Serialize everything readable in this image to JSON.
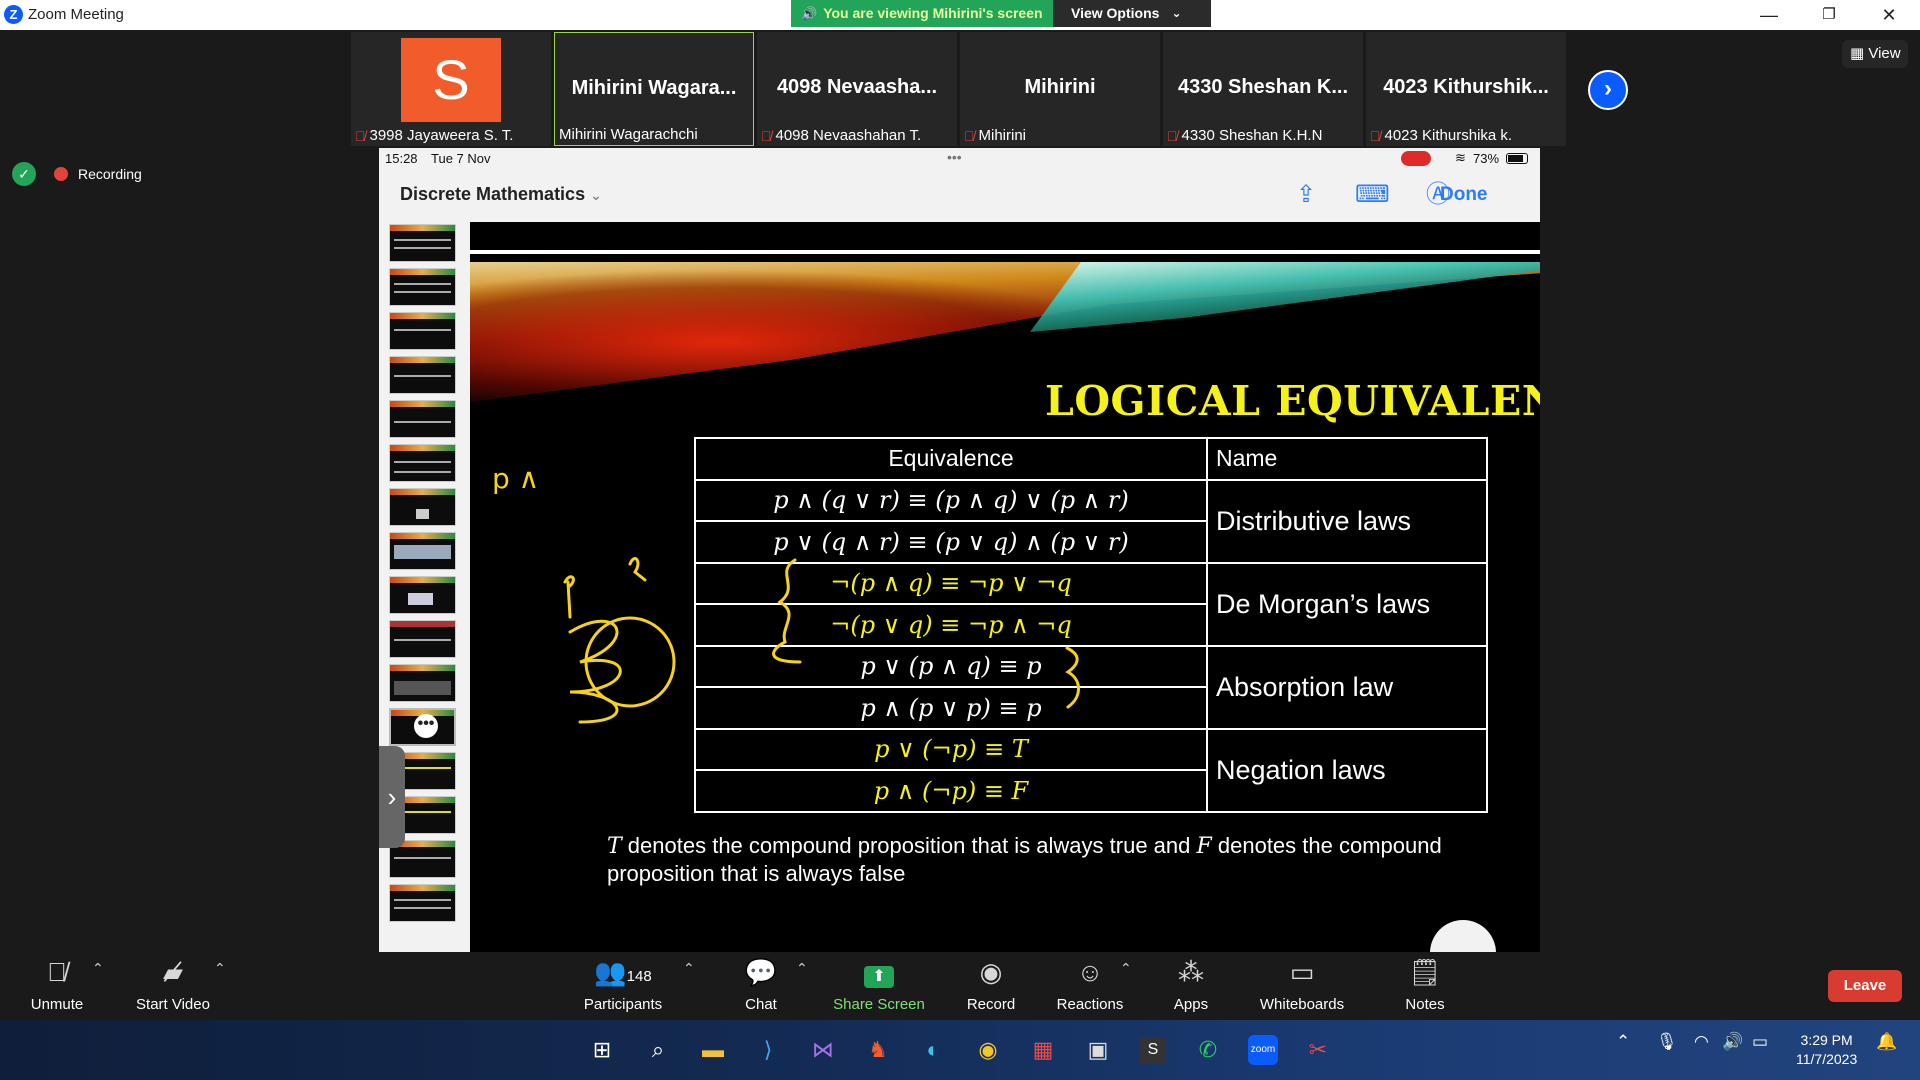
{
  "window": {
    "title": "Zoom Meeting",
    "minimize": "—",
    "restore": "❐",
    "close": "✕"
  },
  "share_banner": {
    "viewing_text": "You are viewing Mihirini's screen",
    "view_options": "View Options"
  },
  "participants": [
    {
      "name": "",
      "label": "3998 Jayaweera S. T.",
      "avatar_letter": "S",
      "muted": true
    },
    {
      "name": "Mihirini  Wagara...",
      "label": "Mihirini Wagarachchi",
      "muted": false,
      "active": true
    },
    {
      "name": "4098  Nevaasha...",
      "label": "4098 Nevaashahan T.",
      "muted": true
    },
    {
      "name": "Mihirini",
      "label": "Mihirini",
      "muted": true
    },
    {
      "name": "4330  Sheshan  K...",
      "label": "4330 Sheshan K.H.N",
      "muted": true
    },
    {
      "name": "4023  Kithurshik...",
      "label": "4023 Kithurshika k.",
      "muted": true
    }
  ],
  "view_button": "View",
  "recording": {
    "label": "Recording"
  },
  "ipad": {
    "time": "15:28",
    "date": "Tue 7 Nov",
    "dots": "•••",
    "battery": "73%",
    "doc_title": "Discrete Mathematics",
    "done": "Done"
  },
  "slide": {
    "title": "LOGICAL EQUIVALENC",
    "col_equivalence": "Equivalence",
    "col_name": "Name",
    "rows": [
      {
        "formula": "p ∧ (q ∨ r) ≡ (p ∧ q) ∨ (p ∧ r)",
        "yellow": false
      },
      {
        "formula": "p ∨ (q ∧ r) ≡ (p ∨ q) ∧ (p ∨ r)",
        "yellow": false
      },
      {
        "formula": "¬(p ∧ q) ≡ ¬p ∨ ¬q",
        "yellow": true
      },
      {
        "formula": "¬(p ∨ q) ≡ ¬p ∧ ¬q",
        "yellow": true
      },
      {
        "formula": "p ∨ (p ∧ q) ≡ p",
        "yellow": false
      },
      {
        "formula": "p ∧ (p ∨ p) ≡ p",
        "yellow": false
      },
      {
        "formula": "p ∨ (¬p) ≡ T",
        "yellow": true
      },
      {
        "formula": "p ∧ (¬p) ≡ F",
        "yellow": true
      }
    ],
    "laws": [
      "Distributive laws",
      "De Morgan’s laws",
      "Absorption law",
      "Negation laws"
    ],
    "caption_t": "T",
    "caption_1": " denotes the compound proposition that is always true and ",
    "caption_f": "F",
    "caption_2": " denotes the compound proposition that is always false",
    "annotation_text": "p ∧"
  },
  "toolbar": {
    "unmute": "Unmute",
    "start_video": "Start Video",
    "participants_count": "148",
    "participants": "Participants",
    "chat": "Chat",
    "share_screen": "Share Screen",
    "record": "Record",
    "reactions": "Reactions",
    "apps": "Apps",
    "whiteboards": "Whiteboards",
    "notes": "Notes",
    "leave": "Leave"
  },
  "taskbar": {
    "time": "3:29 PM",
    "date": "11/7/2023"
  },
  "colors": {
    "zoom_blue": "#0b5cff",
    "share_green": "#23a559",
    "slide_yellow": "#f5f21b",
    "leave_red": "#d83b2f"
  }
}
